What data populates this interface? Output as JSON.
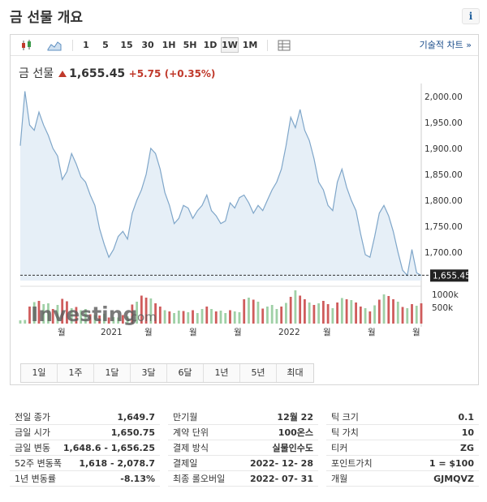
{
  "title": "금 선물 개요",
  "info_label": "i",
  "toolbar": {
    "intervals": [
      "1",
      "5",
      "15",
      "30",
      "1H",
      "5H",
      "1D",
      "1W",
      "1M"
    ],
    "active_interval": "1W",
    "tech_chart_label": "기술적 차트 »"
  },
  "quote": {
    "name": "금 선물",
    "price": "1,655.45",
    "change": "+5.75",
    "change_pct": "(+0.35%)"
  },
  "chart_data": {
    "type": "line",
    "x_tick_labels": [
      "월",
      "2021",
      "월",
      "월",
      "월",
      "2022",
      "월",
      "월",
      "월",
      "월"
    ],
    "y_tick_labels": [
      "2,000.00",
      "1,950.00",
      "1,900.00",
      "1,850.00",
      "1,800.00",
      "1,750.00",
      "1,700.00"
    ],
    "current_label": "1,655.45",
    "volume_labels": [
      "1000k",
      "500k"
    ],
    "ylim": [
      1645,
      2025
    ],
    "values": [
      1905,
      2010,
      1945,
      1935,
      1970,
      1945,
      1925,
      1900,
      1885,
      1840,
      1855,
      1890,
      1870,
      1845,
      1835,
      1810,
      1790,
      1745,
      1715,
      1690,
      1705,
      1730,
      1740,
      1725,
      1775,
      1800,
      1820,
      1850,
      1900,
      1890,
      1860,
      1815,
      1790,
      1755,
      1765,
      1790,
      1785,
      1765,
      1780,
      1790,
      1810,
      1780,
      1770,
      1755,
      1760,
      1795,
      1785,
      1805,
      1810,
      1795,
      1775,
      1790,
      1780,
      1800,
      1820,
      1835,
      1860,
      1905,
      1960,
      1940,
      1975,
      1935,
      1915,
      1880,
      1835,
      1820,
      1790,
      1780,
      1835,
      1860,
      1825,
      1800,
      1780,
      1735,
      1695,
      1690,
      1730,
      1775,
      1790,
      1770,
      1740,
      1700,
      1665,
      1655,
      1705,
      1660,
      1655
    ],
    "volume": [
      80,
      90,
      420,
      530,
      560,
      480,
      500,
      360,
      460,
      610,
      550,
      380,
      410,
      330,
      360,
      230,
      210,
      200,
      240,
      150,
      160,
      150,
      210,
      180,
      470,
      540,
      690,
      640,
      620,
      500,
      420,
      330,
      300,
      260,
      320,
      310,
      280,
      330,
      260,
      360,
      420,
      360,
      300,
      320,
      260,
      330,
      300,
      280,
      600,
      640,
      590,
      540,
      370,
      420,
      460,
      360,
      420,
      510,
      660,
      820,
      690,
      600,
      520,
      460,
      500,
      560,
      480,
      380,
      520,
      630,
      600,
      580,
      520,
      420,
      380,
      300,
      450,
      590,
      720,
      680,
      600,
      540,
      410,
      380,
      480,
      440,
      500
    ],
    "volume_dir": [
      1,
      1,
      0,
      1,
      0,
      1,
      1,
      0,
      1,
      0,
      0,
      1,
      0,
      1,
      1,
      0,
      1,
      0,
      1,
      0,
      1,
      1,
      0,
      1,
      0,
      1,
      0,
      0,
      1,
      0,
      0,
      1,
      0,
      1,
      1,
      0,
      1,
      0,
      1,
      1,
      0,
      1,
      0,
      1,
      1,
      0,
      1,
      1,
      0,
      1,
      0,
      1,
      0,
      1,
      1,
      1,
      0,
      1,
      0,
      1,
      0,
      0,
      1,
      0,
      1,
      0,
      0,
      1,
      0,
      1,
      0,
      1,
      0,
      0,
      1,
      0,
      1,
      0,
      1,
      0,
      0,
      1,
      0,
      1,
      0,
      1,
      0
    ],
    "watermark": "Investing",
    "watermark_suffix": ".com"
  },
  "ranges": [
    "1일",
    "1주",
    "1달",
    "3달",
    "6달",
    "1년",
    "5년",
    "최대"
  ],
  "stats": {
    "col1": [
      {
        "k": "전일 종가",
        "v": "1,649.7"
      },
      {
        "k": "금일 시가",
        "v": "1,650.75"
      },
      {
        "k": "금일 변동",
        "v": "1,648.6 - 1,656.25"
      },
      {
        "k": "52주 변동폭",
        "v": "1,618 - 2,078.7"
      },
      {
        "k": "1년 변동률",
        "v": "-8.13%"
      }
    ],
    "col2": [
      {
        "k": "만기월",
        "v": "12월 22"
      },
      {
        "k": "계약 단위",
        "v": "100온스"
      },
      {
        "k": "결제 방식",
        "v": "실물인수도"
      },
      {
        "k": "결제일",
        "v": "2022- 12- 28"
      },
      {
        "k": "최종 롤오버일",
        "v": "2022- 07- 31"
      }
    ],
    "col3": [
      {
        "k": "틱 크기",
        "v": "0.1"
      },
      {
        "k": "틱 가치",
        "v": "10"
      },
      {
        "k": "티커",
        "v": "ZG"
      },
      {
        "k": "포인트가치",
        "v": "1 = $100"
      },
      {
        "k": "개월",
        "v": "GJMQVZ"
      }
    ]
  },
  "colors": {
    "line": "#7fa6c9",
    "fill": "#e6eff7",
    "up": "#9fd0a6",
    "down": "#cf5c5c"
  }
}
